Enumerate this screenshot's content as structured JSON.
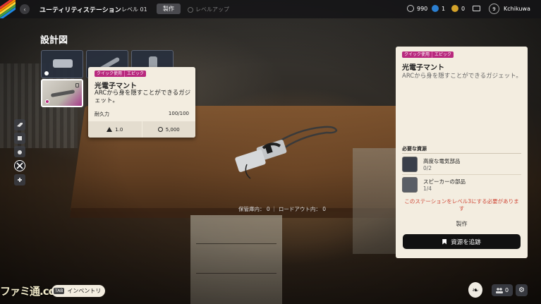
{
  "header": {
    "station_title": "ユーティリティステーション",
    "level": "レベル 01",
    "tab_craft": "製作",
    "tab_levelup": "レベルアップ",
    "currency_a": "990",
    "currency_b": "1",
    "currency_c": "0",
    "player_level": "9",
    "player_name": "Kchikuwa"
  },
  "blueprints": {
    "title": "設計図"
  },
  "tooltip": {
    "tag_1": "クイック使用",
    "tag_2": "エピック",
    "title": "光電子マント",
    "description": "ARCから身を隠すことができるガジェット。",
    "durability_label": "耐久力",
    "durability_value": "100/100",
    "weight": "1.0",
    "price": "5,000"
  },
  "storage": {
    "text": "保管庫内： 0 ｜ ロードアウト内： 0"
  },
  "panel": {
    "tag_1": "クイック使用",
    "tag_2": "エピック",
    "title": "光電子マント",
    "description": "ARCから身を隠すことができるガジェット。",
    "requirements_title": "必要な資源",
    "resources": [
      {
        "name": "高度な電気部品",
        "qty": "0/2"
      },
      {
        "name": "スピーカーの部品",
        "qty": "1/4"
      }
    ],
    "warning": "このステーションをレベル3にする必要がありま す",
    "craft_label": "製作",
    "track_button": "資源を追跡"
  },
  "bottom": {
    "logo_text": "ファミ通.com",
    "inventory_key": "TAB",
    "inventory_label": "インベントリ",
    "party_count": "0"
  },
  "colors": {
    "tag_magenta": "#b8297e",
    "panel_bg": "#f3ede0",
    "warning_red": "#d04a3a"
  }
}
